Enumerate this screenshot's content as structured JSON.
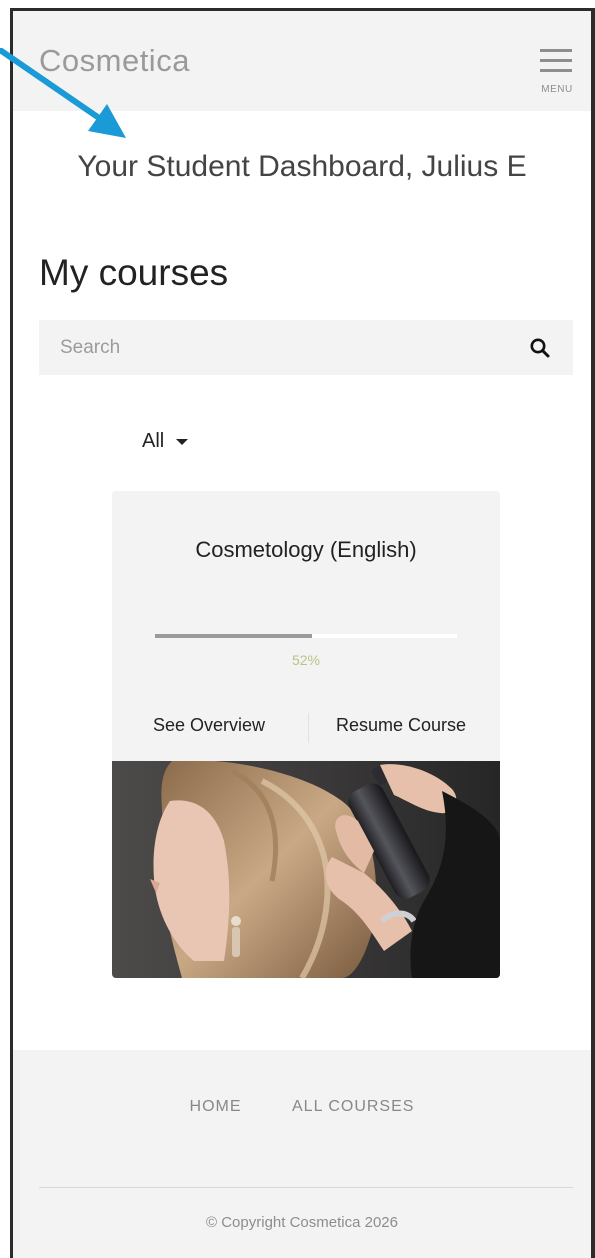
{
  "header": {
    "brand": "Cosmetica",
    "menu_label": "MENU"
  },
  "dashboard": {
    "title": "Your Student Dashboard, Julius E"
  },
  "courses": {
    "heading": "My courses",
    "search_placeholder": "Search",
    "filter_selected": "All",
    "items": [
      {
        "title": "Cosmetology (English)",
        "progress_percent": 52,
        "progress_label": "52%",
        "overview_label": "See Overview",
        "resume_label": "Resume Course",
        "image_icon": "hair-styling-photo"
      }
    ]
  },
  "footer": {
    "nav": [
      "HOME",
      "ALL COURSES"
    ],
    "copyright": "© Copyright Cosmetica 2026"
  },
  "colors": {
    "annotation_arrow": "#1a9ad6",
    "progress_label": "#b6c48a",
    "panel_bg": "#f3f3f3"
  }
}
